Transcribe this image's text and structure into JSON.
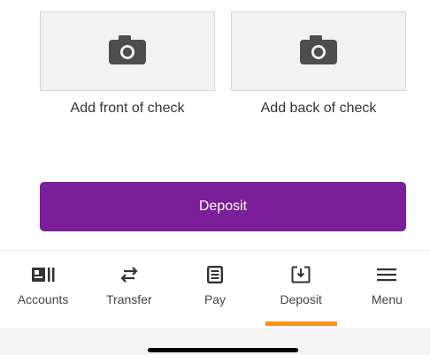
{
  "capture": {
    "front_label": "Add front of check",
    "back_label": "Add back of check",
    "camera_icon": "camera-icon"
  },
  "deposit_button": {
    "label": "Deposit",
    "color": "#7b1e9a"
  },
  "nav": {
    "active_index": 3,
    "indicator_color": "#f7941d",
    "items": [
      {
        "label": "Accounts",
        "icon": "accounts-icon"
      },
      {
        "label": "Transfer",
        "icon": "transfer-arrows-icon"
      },
      {
        "label": "Pay",
        "icon": "pay-document-icon"
      },
      {
        "label": "Deposit",
        "icon": "deposit-download-icon"
      },
      {
        "label": "Menu",
        "icon": "hamburger-menu-icon"
      }
    ]
  }
}
